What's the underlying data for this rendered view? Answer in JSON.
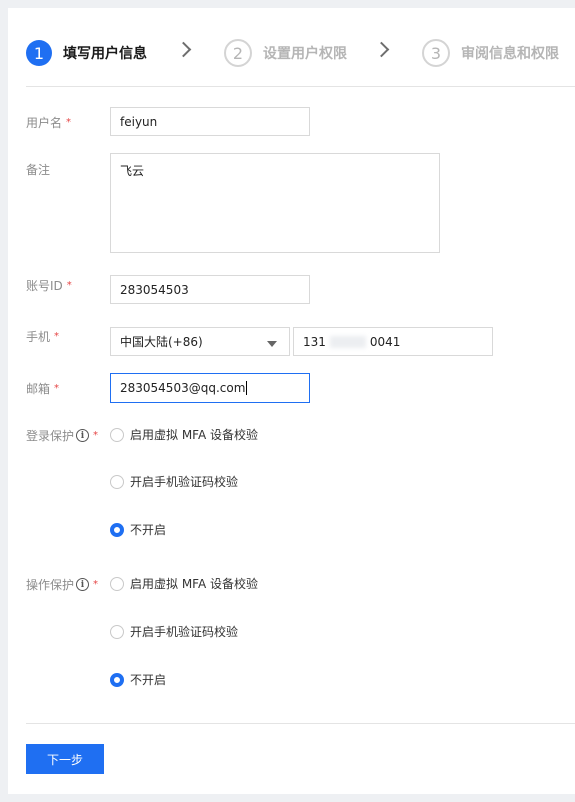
{
  "steps": [
    {
      "num": "1",
      "label": "填写用户信息",
      "state": "active"
    },
    {
      "num": "2",
      "label": "设置用户权限",
      "state": "idle"
    },
    {
      "num": "3",
      "label": "审阅信息和权限",
      "state": "idle"
    }
  ],
  "form": {
    "username": {
      "label": "用户名",
      "value": "feiyun"
    },
    "note": {
      "label": "备注",
      "value": "飞云"
    },
    "account_id": {
      "label": "账号ID",
      "value": "283054503"
    },
    "phone": {
      "label": "手机",
      "region": "中国大陆(+86)",
      "prefix": "131",
      "suffix": "0041"
    },
    "email": {
      "label": "邮箱",
      "value": "283054503@qq.com"
    },
    "required_mark": "*",
    "info_glyph": "i"
  },
  "login_protection": {
    "label": "登录保护",
    "options": [
      "启用虚拟 MFA 设备校验",
      "开启手机验证码校验",
      "不开启"
    ],
    "selected": "不开启"
  },
  "operation_protection": {
    "label": "操作保护",
    "options": [
      "启用虚拟 MFA 设备校验",
      "开启手机验证码校验",
      "不开启"
    ],
    "selected": "不开启"
  },
  "actions": {
    "next_label": "下一步"
  },
  "colors": {
    "accent": "#1f6ff2",
    "required": "#e54545"
  }
}
